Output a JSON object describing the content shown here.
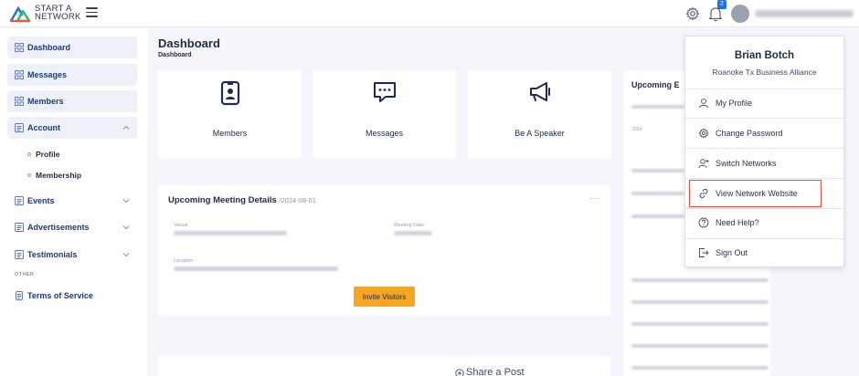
{
  "app": {
    "logo_line1": "START A",
    "logo_line2": "NETWORK"
  },
  "header": {
    "notification_count": "2"
  },
  "sidebar": {
    "items": [
      {
        "label": "Dashboard"
      },
      {
        "label": "Messages"
      },
      {
        "label": "Members"
      },
      {
        "label": "Account"
      },
      {
        "label": "Events"
      },
      {
        "label": "Advertisements"
      },
      {
        "label": "Testimonials"
      },
      {
        "label": "Terms of Service"
      }
    ],
    "account_subitems": [
      {
        "label": "Profile"
      },
      {
        "label": "Membership"
      }
    ],
    "other_label": "OTHER"
  },
  "main": {
    "title": "Dashboard",
    "breadcrumb": "Dashboard",
    "quick_cards": [
      {
        "label": "Members",
        "icon": "id-badge-icon"
      },
      {
        "label": "Messages",
        "icon": "chat-bubble-icon"
      },
      {
        "label": "Be A Speaker",
        "icon": "megaphone-icon"
      }
    ],
    "meeting": {
      "title": "Upcoming Meeting Details",
      "date": "/2024-08-01",
      "venue_label": "Venue:",
      "meeting_date_label": "Meeting Date:",
      "location_label": "Location:",
      "invite_button": "Invite Visitors"
    },
    "share": {
      "label": "Share a Post"
    },
    "upcoming": {
      "title": "Upcoming E",
      "first_date": "2024"
    }
  },
  "user_menu": {
    "name": "Brian Botch",
    "network": "Roanoke Tx Business Alliance",
    "items": [
      {
        "label": "My Profile",
        "icon": "user-icon"
      },
      {
        "label": "Change Password",
        "icon": "gear-icon"
      },
      {
        "label": "Switch Networks",
        "icon": "user-plus-icon"
      },
      {
        "label": "View Network Website",
        "icon": "link-icon"
      },
      {
        "label": "Need Help?",
        "icon": "question-icon"
      },
      {
        "label": "Sign Out",
        "icon": "sign-out-icon"
      }
    ]
  },
  "colors": {
    "accent": "#1d72e8",
    "invite": "#f6a623",
    "highlight_box": "#e0552f"
  }
}
